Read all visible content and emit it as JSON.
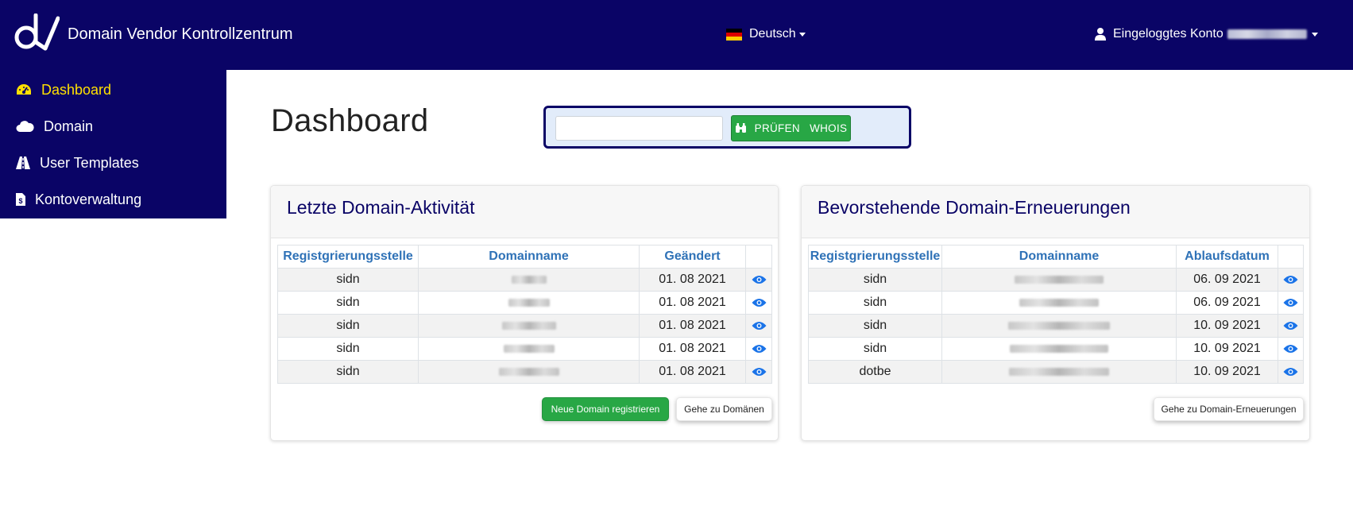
{
  "header": {
    "title": "Domain Vendor Kontrollzentrum",
    "language": "Deutsch",
    "account_label": "Eingeloggtes Konto",
    "account_id_redacted": true,
    "background_color": "#0a0466"
  },
  "sidebar": {
    "items": [
      {
        "label": "Dashboard",
        "icon": "tachometer-icon",
        "active": true
      },
      {
        "label": "Domain",
        "icon": "cloud-icon",
        "active": false
      },
      {
        "label": "User Templates",
        "icon": "road-icon",
        "active": false
      },
      {
        "label": "Kontoverwaltung",
        "icon": "file-invoice-dollar-icon",
        "active": false
      }
    ]
  },
  "main": {
    "page_title": "Dashboard",
    "search": {
      "value": "",
      "button_label": "PRÜFEN   WHOIS"
    },
    "recent_activity": {
      "title": "Letzte Domain-Aktivität",
      "columns": [
        "Registgrierungsstelle",
        "Domainname",
        "Geändert",
        ""
      ],
      "rows": [
        {
          "registrar": "sidn",
          "domain_redacted": true,
          "date": "01. 08 2021"
        },
        {
          "registrar": "sidn",
          "domain_redacted": true,
          "date": "01. 08 2021"
        },
        {
          "registrar": "sidn",
          "domain_redacted": true,
          "date": "01. 08 2021"
        },
        {
          "registrar": "sidn",
          "domain_redacted": true,
          "date": "01. 08 2021"
        },
        {
          "registrar": "sidn",
          "domain_redacted": true,
          "date": "01. 08 2021"
        }
      ],
      "buttons": {
        "register": "Neue Domain registrieren",
        "goto": "Gehe zu Domänen"
      }
    },
    "upcoming_renewals": {
      "title": "Bevorstehende Domain-Erneuerungen",
      "columns": [
        "Registgrierungsstelle",
        "Domainname",
        "Ablaufsdatum",
        ""
      ],
      "rows": [
        {
          "registrar": "sidn",
          "domain_redacted": true,
          "date": "06. 09 2021"
        },
        {
          "registrar": "sidn",
          "domain_redacted": true,
          "date": "06. 09 2021"
        },
        {
          "registrar": "sidn",
          "domain_redacted": true,
          "date": "10. 09 2021"
        },
        {
          "registrar": "sidn",
          "domain_redacted": true,
          "date": "10. 09 2021"
        },
        {
          "registrar": "dotbe",
          "domain_redacted": true,
          "date": "10. 09 2021"
        }
      ],
      "buttons": {
        "goto": "Gehe zu Domain-Erneuerungen"
      }
    }
  },
  "colors": {
    "navy": "#0a0466",
    "active_nav": "#ffe000",
    "green": "#28a745",
    "table_header": "#2f72b7",
    "eye_icon": "#1a73e8"
  }
}
